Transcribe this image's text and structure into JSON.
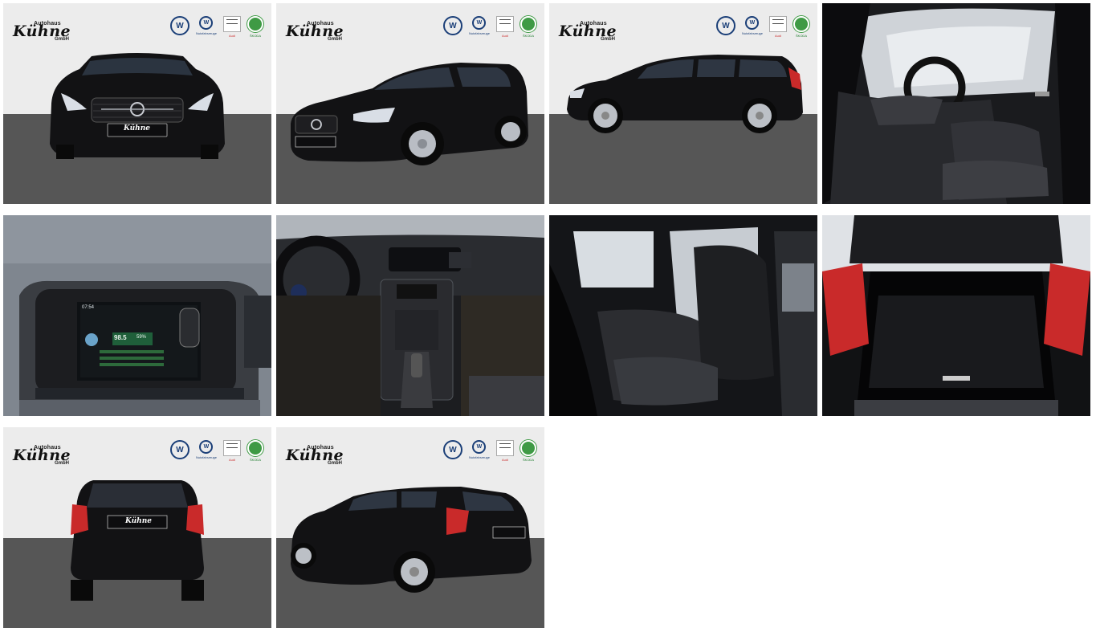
{
  "gallery": {
    "images": [
      {
        "view": "front",
        "dealer": true
      },
      {
        "view": "front-left",
        "dealer": true
      },
      {
        "view": "side",
        "dealer": true
      },
      {
        "view": "interior-driver-door",
        "dealer": false
      },
      {
        "view": "display-screen",
        "dealer": false
      },
      {
        "view": "dashboard",
        "dealer": false
      },
      {
        "view": "rear-seats",
        "dealer": false
      },
      {
        "view": "trunk",
        "dealer": false
      },
      {
        "view": "rear",
        "dealer": true
      },
      {
        "view": "rear-left",
        "dealer": true
      }
    ]
  },
  "dealer": {
    "logo_top": "Autohaus",
    "logo_main": "Kühne",
    "logo_sub": "GmbH",
    "audi_caption": "Audi",
    "audi_caption2": "Service",
    "vw_caption": "Nutzfahrzeuge",
    "skoda_caption": "ŠKODA",
    "plate_text": "Kühne"
  },
  "screen": {
    "time": "07:54",
    "value_main": "98.5",
    "value_pct": "59%"
  },
  "colors": {
    "studio_bg": "#ececec",
    "floor": "#565656",
    "car_body": "#121214",
    "tail_light": "#c92a2a",
    "vw_blue": "#1b3f78",
    "skoda_green": "#3f9a45"
  }
}
